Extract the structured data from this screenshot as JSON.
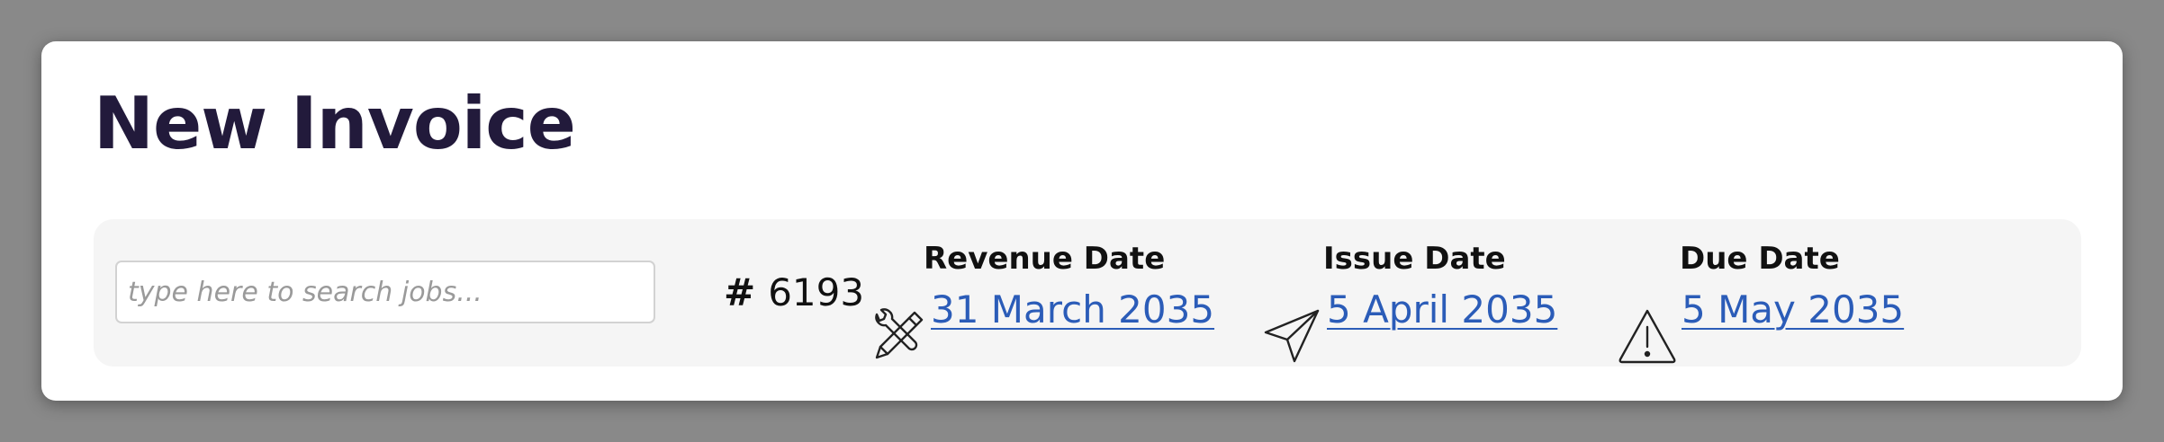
{
  "header": {
    "title": "New Invoice"
  },
  "search": {
    "placeholder": "type here to search jobs...",
    "value": ""
  },
  "invoice": {
    "hash": "#",
    "number": "6193"
  },
  "dates": {
    "revenue": {
      "label": "Revenue Date",
      "value": "31 March 2035",
      "icon": "tools-icon"
    },
    "issue": {
      "label": "Issue Date",
      "value": "5 April 2035",
      "icon": "paper-plane-icon"
    },
    "due": {
      "label": "Due Date",
      "value": "5 May 2035",
      "icon": "warning-icon"
    }
  },
  "colors": {
    "background": "#898989",
    "card": "#ffffff",
    "panel": "#f5f5f5",
    "title": "#221a3b",
    "link": "#2b5cb8"
  }
}
